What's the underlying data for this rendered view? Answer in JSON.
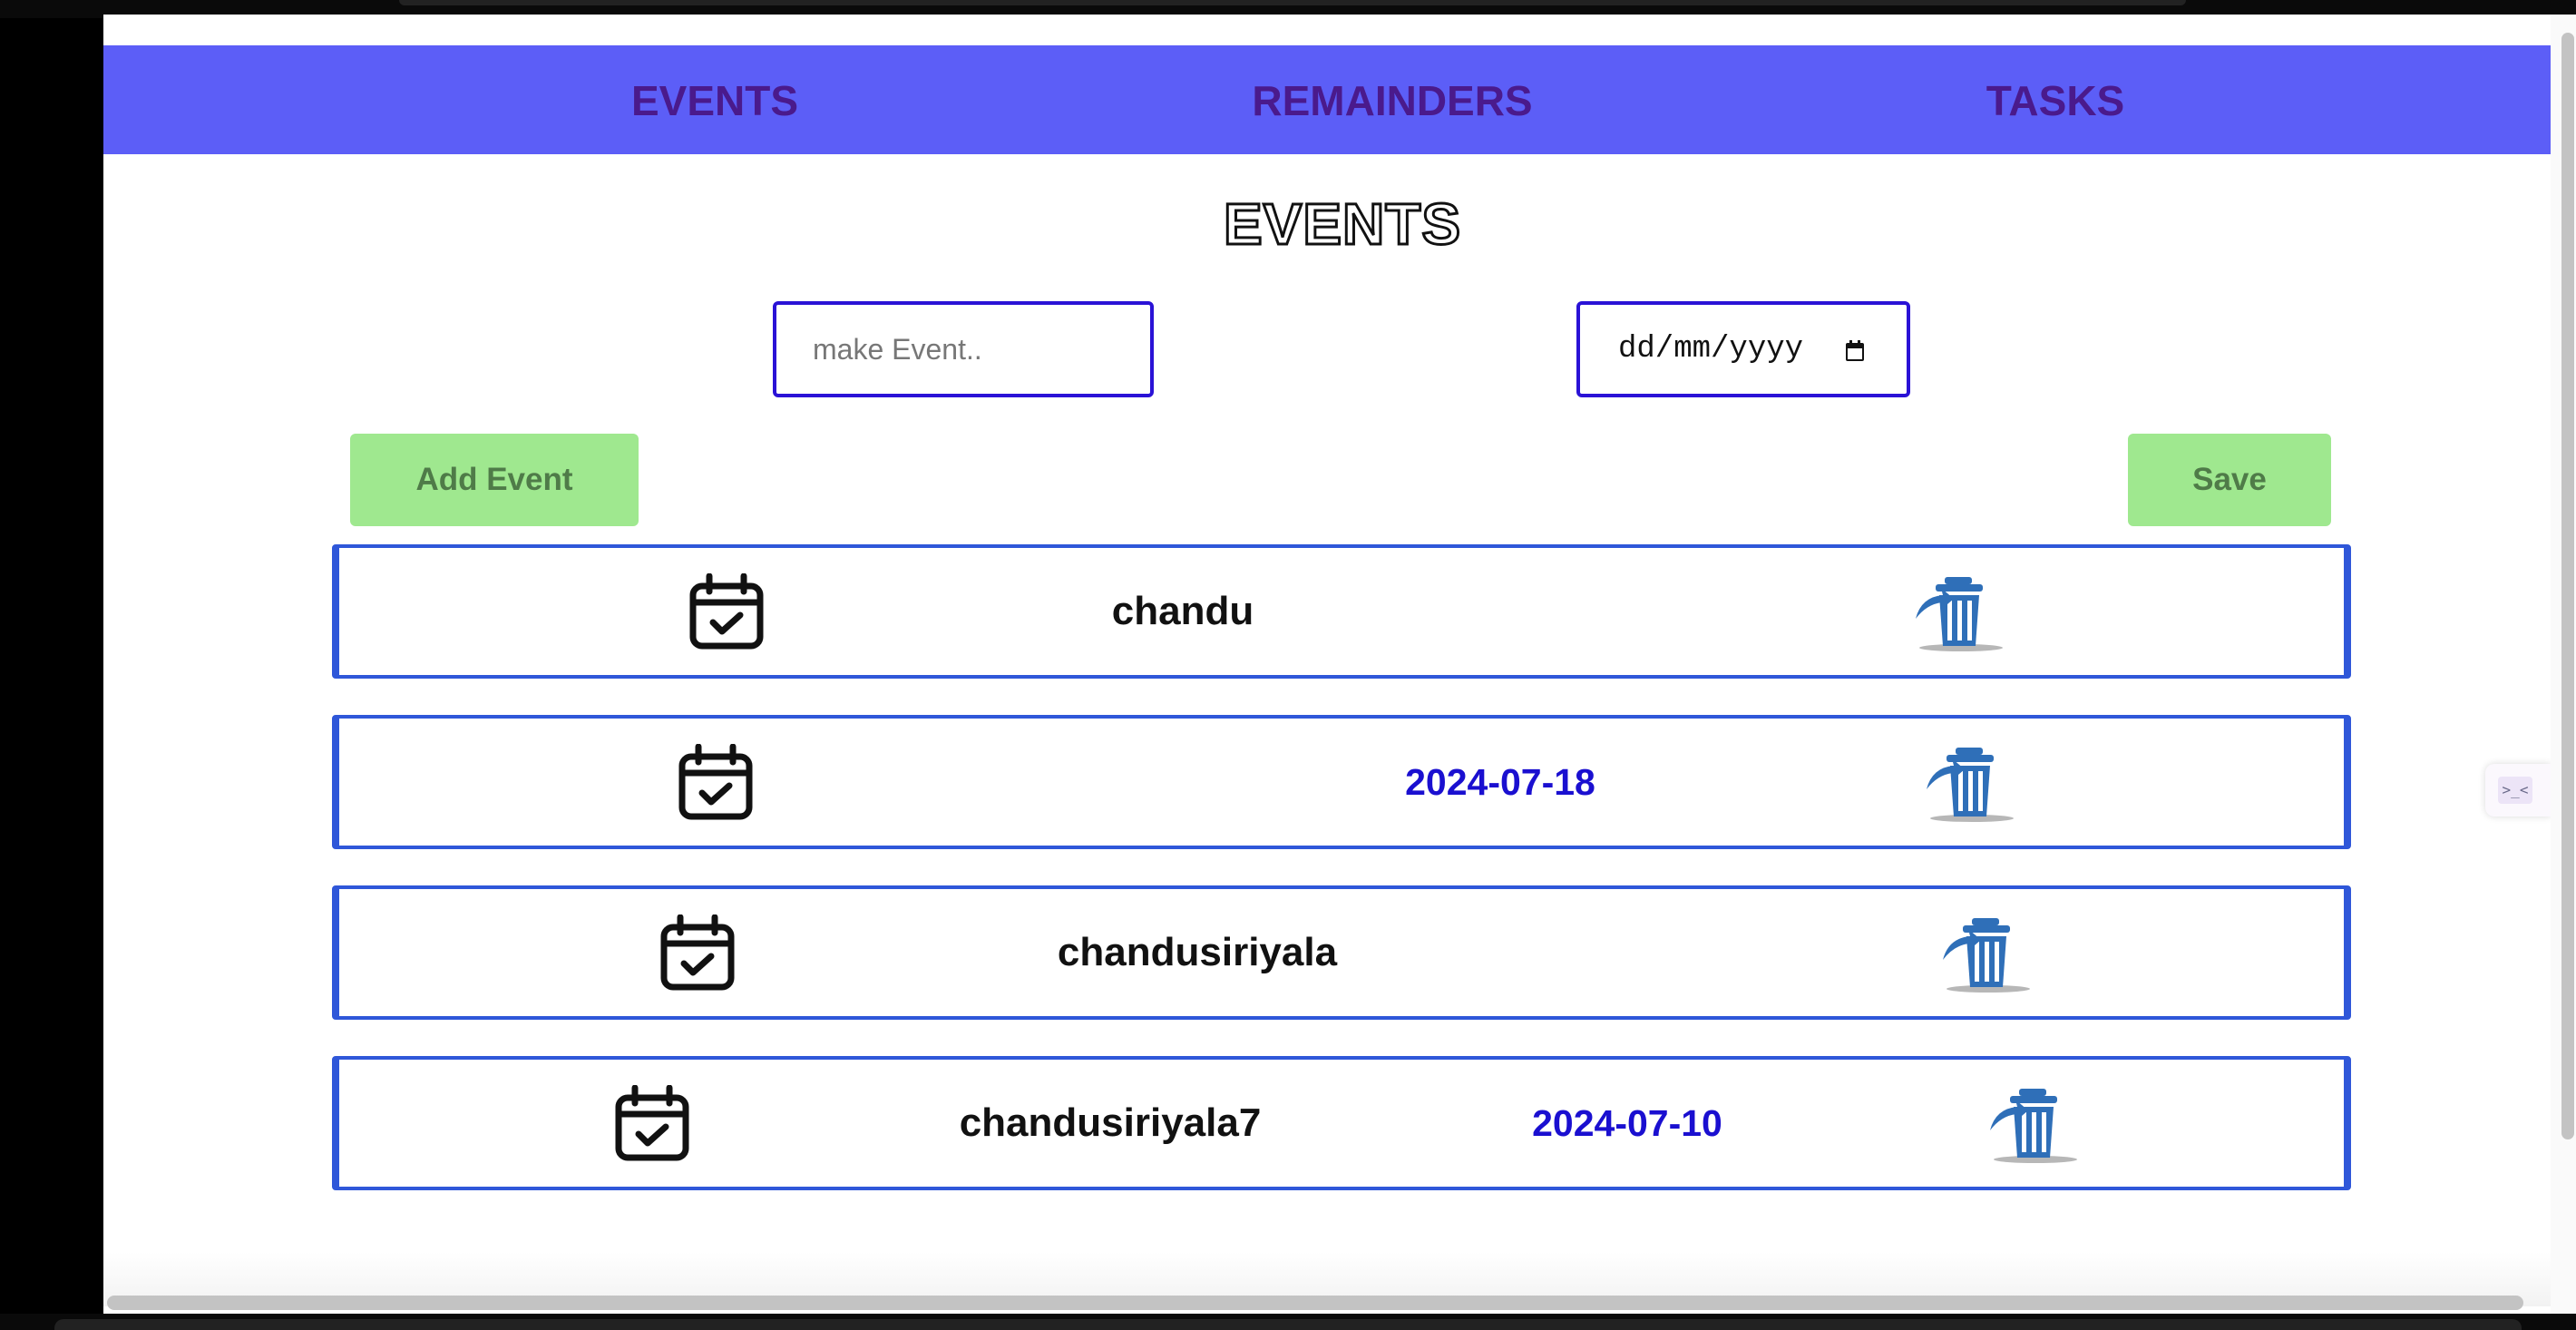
{
  "nav": {
    "items": [
      {
        "label": "EVENTS"
      },
      {
        "label": "REMAINDERS"
      },
      {
        "label": "TASKS"
      }
    ]
  },
  "heading": "EVENTS",
  "form": {
    "event_placeholder": "make Event..",
    "event_value": "",
    "date_placeholder": "dd/mm/yyyy"
  },
  "buttons": {
    "add_label": "Add Event",
    "save_label": "Save"
  },
  "events": [
    {
      "name": "chandu",
      "date": ""
    },
    {
      "name": "",
      "date": "2024-07-18"
    },
    {
      "name": "chandusiriyala",
      "date": ""
    },
    {
      "name": "chandusiriyala7",
      "date": "2024-07-10"
    }
  ],
  "icons": {
    "event_icon": "calendar-check-icon",
    "delete_icon": "trash-icon",
    "date_picker_icon": "calendar-icon"
  },
  "colors": {
    "nav_bg": "#5c5ef7",
    "nav_text": "#4a1a8c",
    "input_border": "#2a12d6",
    "button_bg": "#9fe88f",
    "row_border": "#2f57d9",
    "date_text": "#1a0fd0",
    "trash": "#2f6fb8"
  }
}
